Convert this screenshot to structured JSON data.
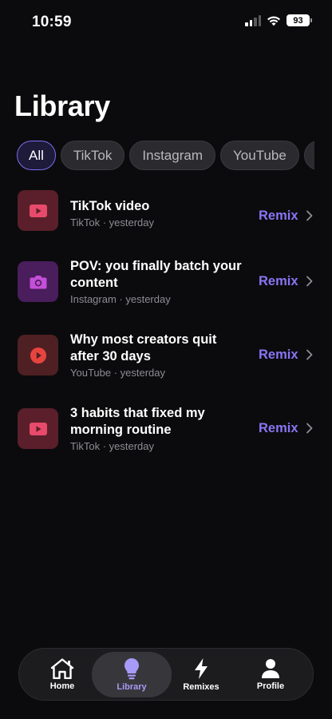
{
  "status_bar": {
    "time": "10:59",
    "battery": "93"
  },
  "page": {
    "title": "Library"
  },
  "filters": [
    {
      "label": "All",
      "active": true
    },
    {
      "label": "TikTok",
      "active": false
    },
    {
      "label": "Instagram",
      "active": false
    },
    {
      "label": "YouTube",
      "active": false
    }
  ],
  "items": [
    {
      "title": "TikTok video",
      "platform": "TikTok",
      "when": "yesterday",
      "subtitle": "TikTok · yesterday",
      "action": "Remix",
      "icon": "play-rect-icon",
      "thumb_bg": "#5a1f2a",
      "icon_color": "#e84a6b"
    },
    {
      "title": "POV: you finally batch your content",
      "platform": "Instagram",
      "when": "yesterday",
      "subtitle": "Instagram · yesterday",
      "action": "Remix",
      "icon": "camera-icon",
      "thumb_bg": "#4a1d5c",
      "icon_color": "#c44fd8"
    },
    {
      "title": "Why most creators quit after 30 days",
      "platform": "YouTube",
      "when": "yesterday",
      "subtitle": "YouTube · yesterday",
      "action": "Remix",
      "icon": "play-circle-icon",
      "thumb_bg": "#4f2023",
      "icon_color": "#e8443f"
    },
    {
      "title": "3 habits that fixed my morning routine",
      "platform": "TikTok",
      "when": "yesterday",
      "subtitle": "TikTok · yesterday",
      "action": "Remix",
      "icon": "play-rect-icon",
      "thumb_bg": "#5a1f2a",
      "icon_color": "#e84a6b"
    }
  ],
  "tabbar": {
    "tabs": [
      {
        "label": "Home",
        "icon": "home-icon",
        "active": false
      },
      {
        "label": "Library",
        "icon": "lightbulb-icon",
        "active": true
      },
      {
        "label": "Remixes",
        "icon": "lightning-icon",
        "active": false
      },
      {
        "label": "Profile",
        "icon": "person-icon",
        "active": false
      }
    ]
  },
  "colors": {
    "accent": "#8b74f5",
    "background": "#0b0b0d"
  }
}
